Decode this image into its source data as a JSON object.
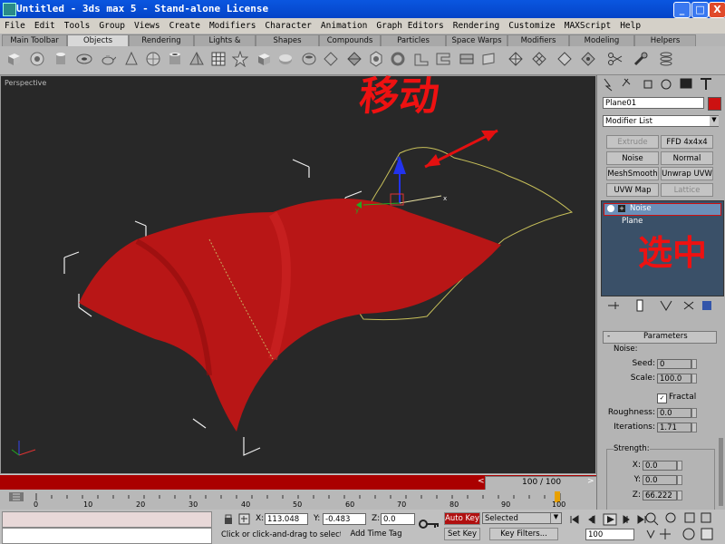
{
  "window": {
    "title": "Untitled - 3ds max 5 - Stand-alone License",
    "min": "_",
    "max": "□",
    "close": "X"
  },
  "menu": [
    "File",
    "Edit",
    "Tools",
    "Group",
    "Views",
    "Create",
    "Modifiers",
    "Character",
    "Animation",
    "Graph Editors",
    "Rendering",
    "Customize",
    "MAXScript",
    "Help"
  ],
  "tabs": [
    "Main Toolbar",
    "Objects",
    "Rendering",
    "Lights & Cameras",
    "Shapes",
    "Compounds",
    "Particles",
    "Space Warps",
    "Modifiers",
    "Modeling",
    "Helpers"
  ],
  "active_tab": "Objects",
  "viewport": {
    "label": "Perspective",
    "annotation_move": "移动",
    "annotation_select": "选中",
    "axes": {
      "x": "x",
      "y": "y",
      "z": "z"
    }
  },
  "command_panel": {
    "object_name": "Plane01",
    "object_color": "#cc1111",
    "modifier_list": "Modifier List",
    "buttons": [
      "Extrude",
      "FFD 4x4x4",
      "Noise",
      "Normal",
      "MeshSmooth",
      "Unwrap UVW",
      "UVW Map",
      "Lattice"
    ],
    "dim_buttons": [
      "Extrude",
      "Lattice"
    ],
    "stack": [
      {
        "label": "Noise",
        "selected": true
      },
      {
        "label": "Plane",
        "selected": false
      }
    ],
    "parameters": {
      "rollout": "Parameters",
      "minus": "-",
      "noise_group": "Noise:",
      "seed_label": "Seed:",
      "seed": "0",
      "scale_label": "Scale:",
      "scale": "100.0",
      "fractal_label": "Fractal",
      "fractal_check": "✓",
      "roughness_label": "Roughness:",
      "roughness": "0.0",
      "iterations_label": "Iterations:",
      "iterations": "1.71",
      "strength_group": "Strength:",
      "x_label": "X:",
      "x": "0.0",
      "y_label": "Y:",
      "y": "0.0",
      "z_label": "Z:",
      "z": "66.222"
    }
  },
  "timeline": {
    "slider": "100 / 100",
    "ticks": [
      "0",
      "10",
      "20",
      "30",
      "40",
      "50",
      "60",
      "70",
      "80",
      "90",
      "100"
    ],
    "prev": "<",
    "next": ">"
  },
  "status": {
    "prompt": "Click or click-and-drag to select obj",
    "add_time_tag": "Add Time Tag",
    "x_label": "X:",
    "x": "113.048",
    "y_label": "Y:",
    "y": "-0.483",
    "z_label": "Z:",
    "z": "0.0",
    "auto_key": "Auto Key",
    "set_key": "Set Key",
    "selected": "Selected",
    "key_filters": "Key Filters...",
    "frame": "100"
  },
  "colors": {
    "accent_red": "#cc1111",
    "titlebar": "#0a56e0",
    "viewport_bg": "#282828"
  }
}
